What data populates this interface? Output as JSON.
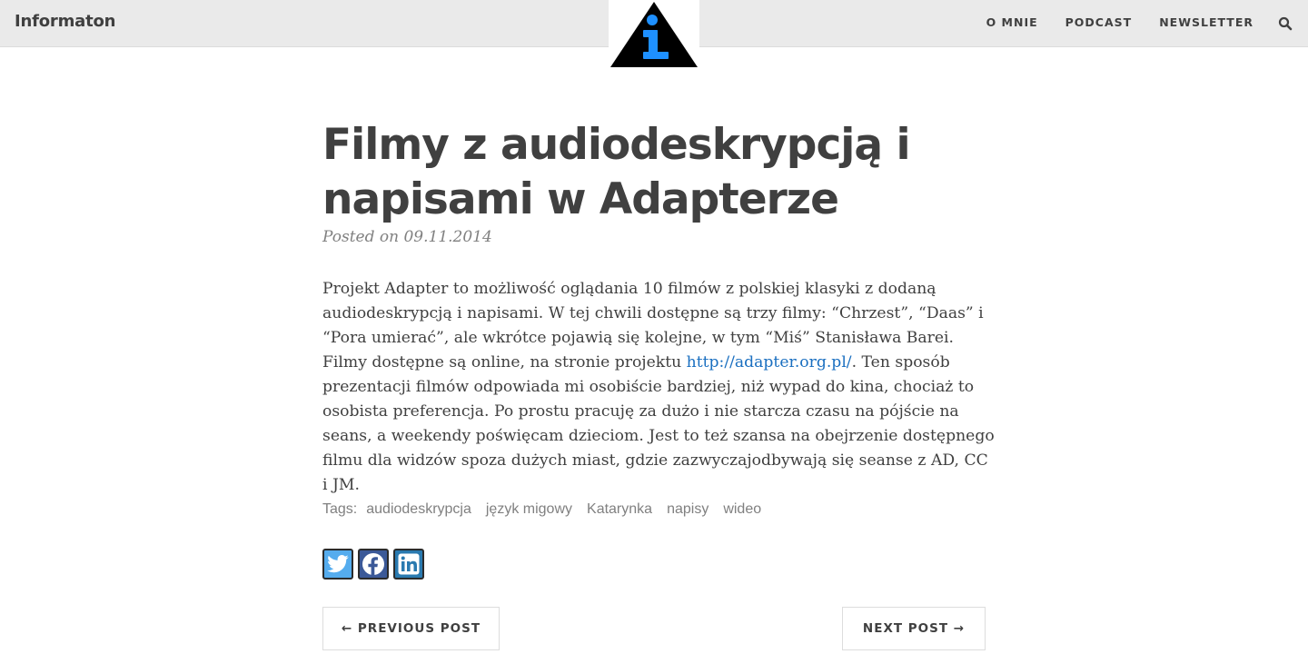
{
  "navbar": {
    "brand": "Informaton",
    "links": [
      "O MNIE",
      "PODCAST",
      "NEWSLETTER"
    ],
    "search_icon": "search-icon",
    "logo_icon": "info-triangle-logo-icon"
  },
  "post": {
    "title": "Filmy z audiodeskrypcją i napisami w Adapterze",
    "meta": "Posted on 09.11.2014",
    "body_before_link": "Projekt Adapter to możliwość oglądania 10 filmów z polskiej klasyki z dodaną audiodeskrypcją i napisami. W tej chwili dostępne są trzy filmy: “Chrzest”, “Daas” i “Pora umierać”, ale wkrótce pojawią się kolejne, w tym “Miś” Stanisława Barei. Filmy dostępne są online, na stronie projektu ",
    "body_link": "http://adapter.org.pl/",
    "body_after_link": ". Ten sposób prezentacji filmów odpowiada mi osobiście bardziej, niż wypad do kina, chociaż to osobista preferencja. Po prostu pracuję za dużo i nie starcza czasu na pójście na seans, a weekendy poświęcam dzieciom. Jest to też szansa na obejrzenie dostępnego filmu dla widzów spoza dużych miast, gdzie zazwyczajodbywają się seanse z AD, CC i JM."
  },
  "tags": {
    "label": "Tags:",
    "items": [
      "audiodeskrypcja",
      "język migowy",
      "Katarynka",
      "napisy",
      "wideo"
    ]
  },
  "share": {
    "icons": [
      "twitter-icon",
      "facebook-icon",
      "linkedin-icon"
    ],
    "colors": {
      "twitter": "#55acee",
      "facebook": "#3b5998",
      "linkedin": "#2a7ab0"
    }
  },
  "pager": {
    "prev": "← PREVIOUS POST",
    "next": "NEXT POST →"
  },
  "colors": {
    "navbar_bg": "#eaeaea",
    "text": "#404040",
    "meta": "#808080",
    "link": "#1a6fc0",
    "logo_accent": "#1e90ff"
  }
}
